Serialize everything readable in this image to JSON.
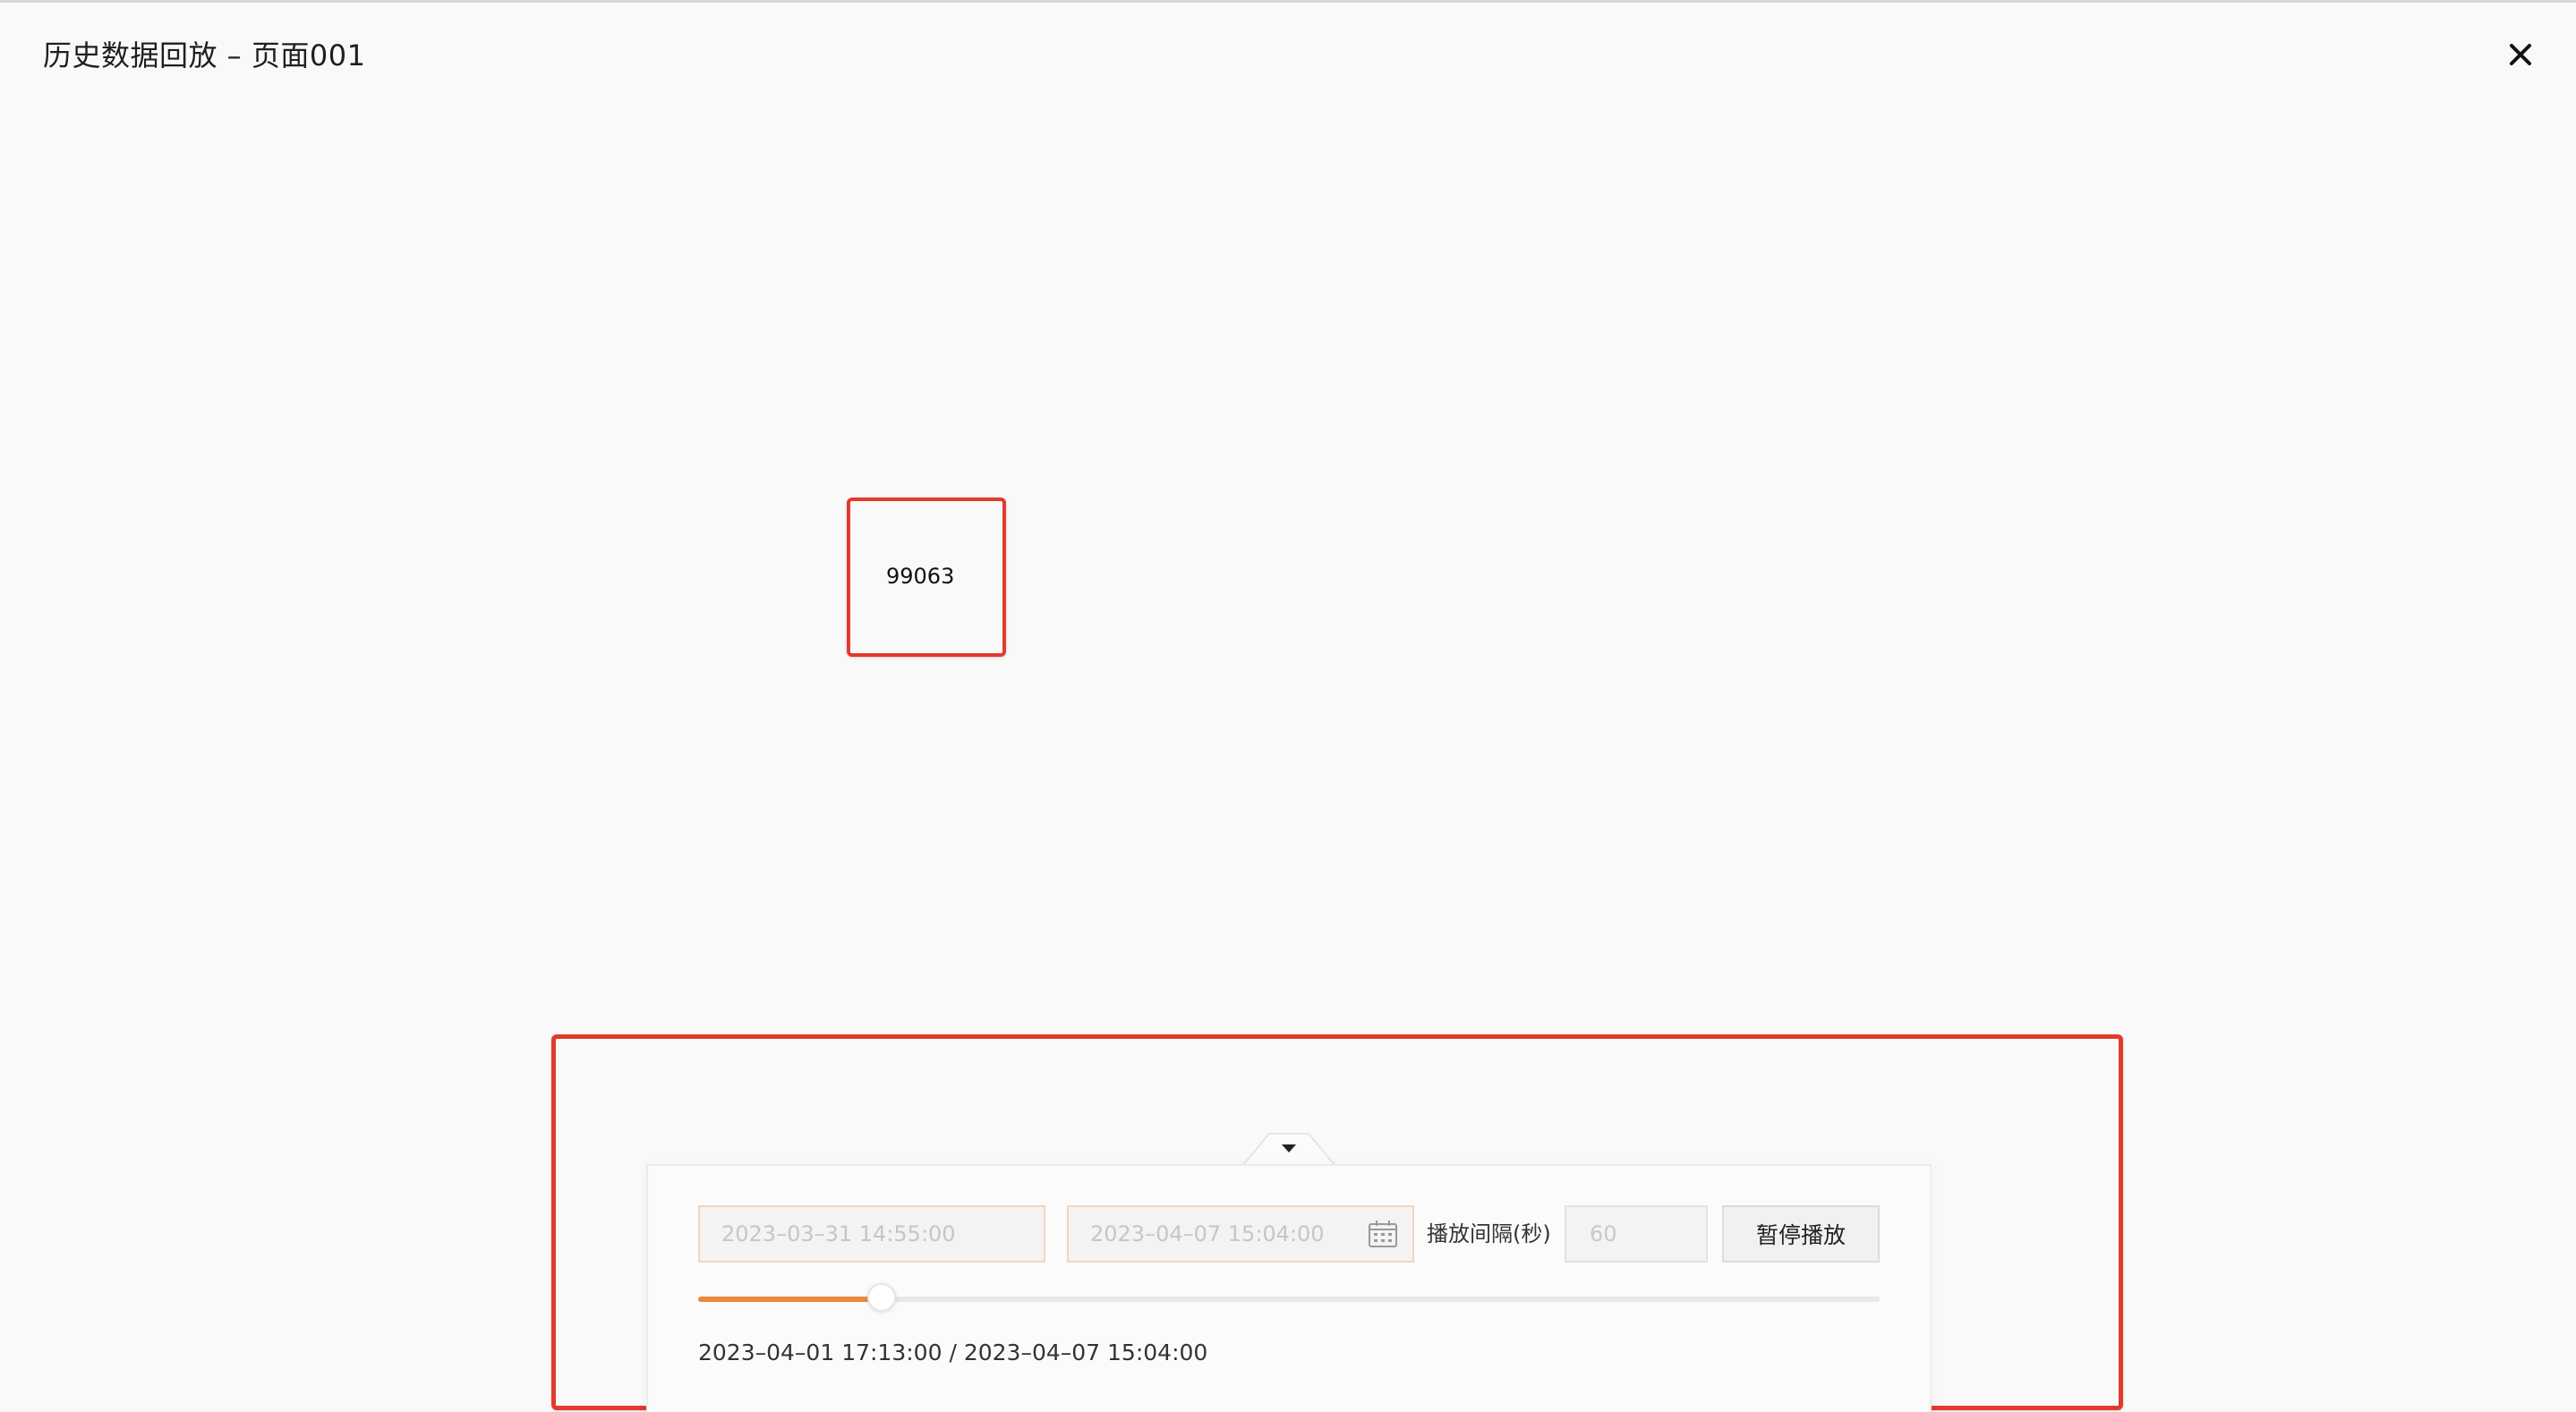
{
  "header": {
    "title": "历史数据回放 – 页面001"
  },
  "widget": {
    "value": "99063"
  },
  "playback": {
    "start_time": "2023–03–31 14:55:00",
    "end_time": "2023–04–07 15:04:00",
    "interval_label": "播放间隔(秒)",
    "interval_value": "60",
    "pause_label": "暂停播放",
    "progress_fraction": 0.155,
    "current_time": "2023–04–01 17:13:00",
    "separator": "/",
    "total_time": "2023–04–07 15:04:00"
  },
  "colors": {
    "highlight_border": "#e23a2d",
    "progress_fill": "#ec8a3a"
  },
  "icons": {
    "close": "close-icon",
    "collapse": "caret-down-icon",
    "calendar": "calendar-icon"
  }
}
